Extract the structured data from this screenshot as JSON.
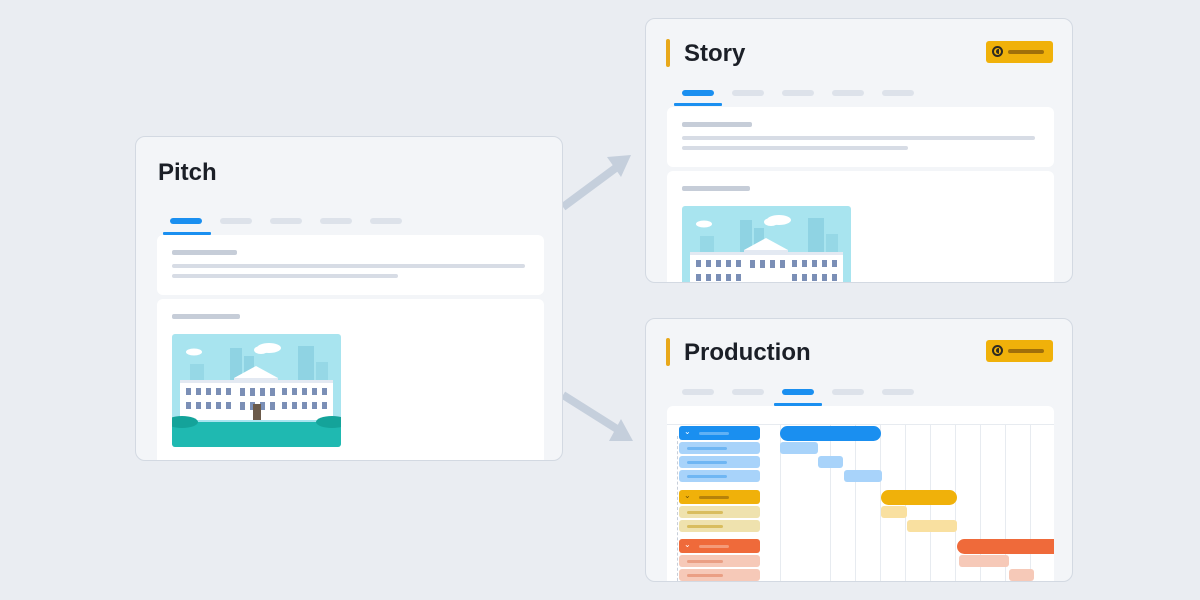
{
  "pitch": {
    "title": "Pitch"
  },
  "story": {
    "title": "Story"
  },
  "production": {
    "title": "Production"
  },
  "colors": {
    "background": "#eaedf2",
    "card": "#f3f5f8",
    "card_border": "#d3d9e2",
    "accent_blue": "#1a8ff0",
    "accent_yellow": "#f0b10a",
    "accent_orange": "#ef6a3a",
    "arrow": "#c5cfdc"
  },
  "icons": {
    "badge": "progress-clock-icon",
    "flow_arrow": "arrow-right-icon",
    "collapse": "chevron-down-icon",
    "illustration": "white-house-illustration"
  }
}
